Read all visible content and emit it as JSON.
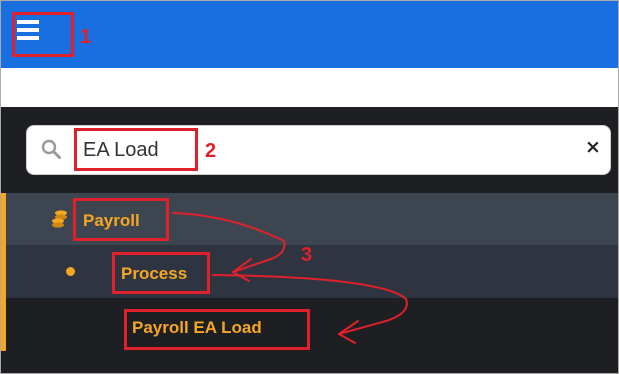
{
  "search": {
    "value": "EA Load",
    "clear_glyph": "×"
  },
  "menu": {
    "items": [
      {
        "label": "Payroll",
        "icon": "coins-icon"
      },
      {
        "label": "Process",
        "icon": "bullet-dot-icon"
      },
      {
        "label": "Payroll EA Load"
      }
    ]
  },
  "annotations": {
    "step1": "1",
    "step2": "2",
    "step3": "3"
  },
  "colors": {
    "topbar": "#1a6fe0",
    "sidebar": "#1d1f22",
    "accent": "#f5a623",
    "annotation": "#e0202a"
  }
}
